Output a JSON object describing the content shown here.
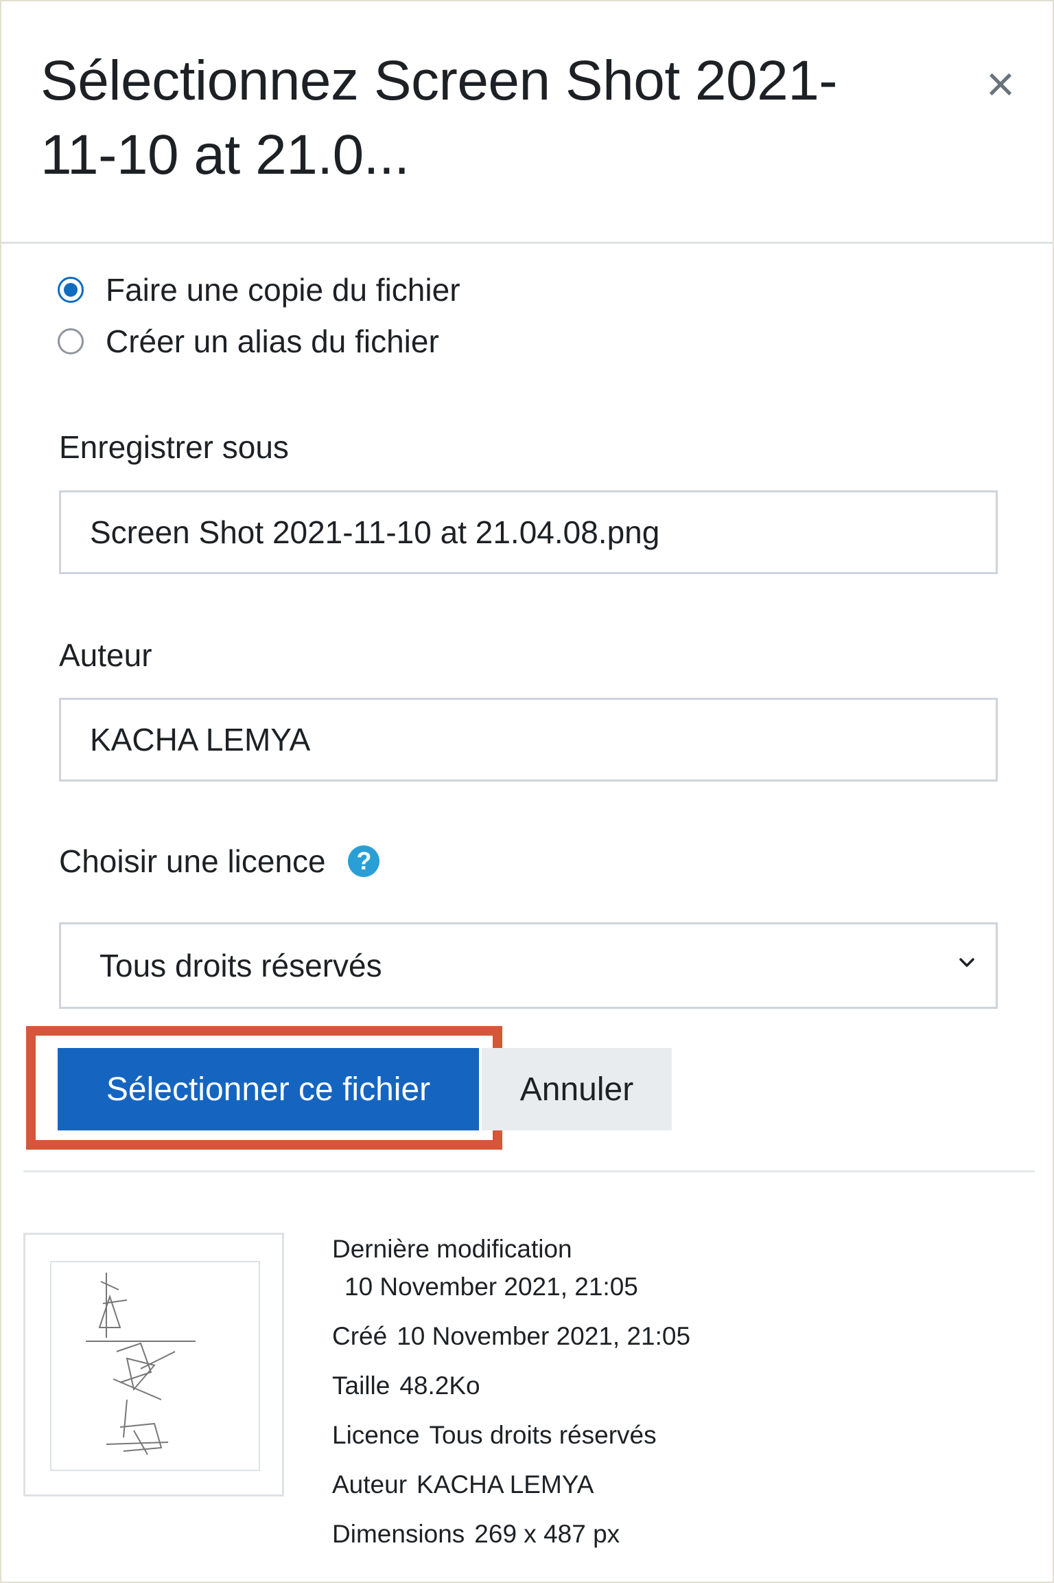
{
  "dialog": {
    "title": "Sélectionnez Screen Shot 2021-11-10 at 21.0...",
    "close_icon": "close-icon",
    "close_glyph": "×"
  },
  "options": [
    {
      "label": "Faire une copie du fichier",
      "checked": true
    },
    {
      "label": "Créer un alias du fichier",
      "checked": false
    }
  ],
  "save_as": {
    "label": "Enregistrer sous",
    "value": "Screen Shot 2021-11-10 at 21.04.08.png"
  },
  "author": {
    "label": "Auteur",
    "value": "KACHA LEMYA"
  },
  "license": {
    "label": "Choisir une licence",
    "help_icon": "help-icon",
    "help_glyph": "?",
    "selected": "Tous droits réservés"
  },
  "buttons": {
    "select": "Sélectionner ce fichier",
    "cancel": "Annuler"
  },
  "file_info": {
    "modified_label": "Dernière modification",
    "modified_value": "10 November 2021, 21:05",
    "created_label": "Créé",
    "created_value": "10 November 2021, 21:05",
    "size_label": "Taille",
    "size_value": "48.2Ko",
    "license_label": "Licence",
    "license_value": "Tous droits réservés",
    "author_label": "Auteur",
    "author_value": "KACHA LEMYA",
    "dimensions_label": "Dimensions",
    "dimensions_value": "269 x 487 px"
  },
  "colors": {
    "primary": "#1565c0",
    "highlight": "#d4573a",
    "radio_checked": "#0f6cbf"
  }
}
